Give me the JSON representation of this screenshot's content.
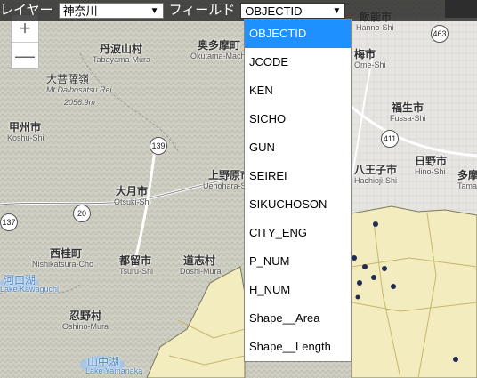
{
  "toolbar": {
    "layer_label": "レイヤー",
    "layer_value": "神奈川",
    "field_label": "フィールド",
    "field_value": "OBJECTID"
  },
  "zoom": {
    "in_label": "+",
    "out_label": "—"
  },
  "field_options": [
    "OBJECTID",
    "JCODE",
    "KEN",
    "SICHO",
    "GUN",
    "SEIREI",
    "SIKUCHOSON",
    "CITY_ENG",
    "P_NUM",
    "H_NUM",
    "Shape__Area",
    "Shape__Length"
  ],
  "selected_option_index": 0,
  "map_labels": [
    {
      "text": "丹波山村",
      "sub": "Tabayama-Mura"
    },
    {
      "text": "奥多摩町",
      "sub": "Okutama-Machi"
    },
    {
      "text": "大菩薩嶺",
      "sub": "Mt Daibosatsu Rei"
    },
    {
      "text": "2056.9m",
      "sub": ""
    },
    {
      "text": "甲州市",
      "sub": "Koshu-Shi"
    },
    {
      "text": "大月市",
      "sub": "Otsuki-Shi"
    },
    {
      "text": "上野原市",
      "sub": "Uenohara-Shi"
    },
    {
      "text": "西桂町",
      "sub": "Nishikatsura-Cho"
    },
    {
      "text": "都留市",
      "sub": "Tsuru-Shi"
    },
    {
      "text": "道志村",
      "sub": "Doshi-Mura"
    },
    {
      "text": "忍野村",
      "sub": "Oshino-Mura"
    },
    {
      "text": "河口湖",
      "sub": "Lake Kawaguchi"
    },
    {
      "text": "山中湖",
      "sub": "Lake Yamanaka"
    },
    {
      "text": "飯能市",
      "sub": "Hanno-Shi"
    },
    {
      "text": "梅市",
      "sub": "Ome-Shi"
    },
    {
      "text": "福生市",
      "sub": "Fussa-Shi"
    },
    {
      "text": "八王子市",
      "sub": "Hachioji-Shi"
    },
    {
      "text": "日野市",
      "sub": "Hino-Shi"
    },
    {
      "text": "多摩",
      "sub": "Tama-Shi"
    }
  ],
  "road_shields": [
    "463",
    "139",
    "411",
    "20",
    "137"
  ]
}
